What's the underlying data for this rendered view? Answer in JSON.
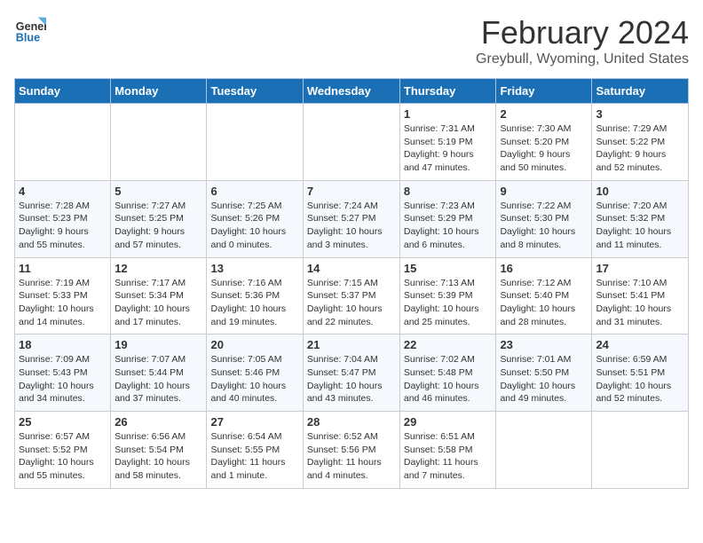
{
  "header": {
    "logo_line1": "General",
    "logo_line2": "Blue",
    "month_title": "February 2024",
    "location": "Greybull, Wyoming, United States"
  },
  "days_of_week": [
    "Sunday",
    "Monday",
    "Tuesday",
    "Wednesday",
    "Thursday",
    "Friday",
    "Saturday"
  ],
  "weeks": [
    [
      {
        "day": "",
        "info": ""
      },
      {
        "day": "",
        "info": ""
      },
      {
        "day": "",
        "info": ""
      },
      {
        "day": "",
        "info": ""
      },
      {
        "day": "1",
        "info": "Sunrise: 7:31 AM\nSunset: 5:19 PM\nDaylight: 9 hours\nand 47 minutes."
      },
      {
        "day": "2",
        "info": "Sunrise: 7:30 AM\nSunset: 5:20 PM\nDaylight: 9 hours\nand 50 minutes."
      },
      {
        "day": "3",
        "info": "Sunrise: 7:29 AM\nSunset: 5:22 PM\nDaylight: 9 hours\nand 52 minutes."
      }
    ],
    [
      {
        "day": "4",
        "info": "Sunrise: 7:28 AM\nSunset: 5:23 PM\nDaylight: 9 hours\nand 55 minutes."
      },
      {
        "day": "5",
        "info": "Sunrise: 7:27 AM\nSunset: 5:25 PM\nDaylight: 9 hours\nand 57 minutes."
      },
      {
        "day": "6",
        "info": "Sunrise: 7:25 AM\nSunset: 5:26 PM\nDaylight: 10 hours\nand 0 minutes."
      },
      {
        "day": "7",
        "info": "Sunrise: 7:24 AM\nSunset: 5:27 PM\nDaylight: 10 hours\nand 3 minutes."
      },
      {
        "day": "8",
        "info": "Sunrise: 7:23 AM\nSunset: 5:29 PM\nDaylight: 10 hours\nand 6 minutes."
      },
      {
        "day": "9",
        "info": "Sunrise: 7:22 AM\nSunset: 5:30 PM\nDaylight: 10 hours\nand 8 minutes."
      },
      {
        "day": "10",
        "info": "Sunrise: 7:20 AM\nSunset: 5:32 PM\nDaylight: 10 hours\nand 11 minutes."
      }
    ],
    [
      {
        "day": "11",
        "info": "Sunrise: 7:19 AM\nSunset: 5:33 PM\nDaylight: 10 hours\nand 14 minutes."
      },
      {
        "day": "12",
        "info": "Sunrise: 7:17 AM\nSunset: 5:34 PM\nDaylight: 10 hours\nand 17 minutes."
      },
      {
        "day": "13",
        "info": "Sunrise: 7:16 AM\nSunset: 5:36 PM\nDaylight: 10 hours\nand 19 minutes."
      },
      {
        "day": "14",
        "info": "Sunrise: 7:15 AM\nSunset: 5:37 PM\nDaylight: 10 hours\nand 22 minutes."
      },
      {
        "day": "15",
        "info": "Sunrise: 7:13 AM\nSunset: 5:39 PM\nDaylight: 10 hours\nand 25 minutes."
      },
      {
        "day": "16",
        "info": "Sunrise: 7:12 AM\nSunset: 5:40 PM\nDaylight: 10 hours\nand 28 minutes."
      },
      {
        "day": "17",
        "info": "Sunrise: 7:10 AM\nSunset: 5:41 PM\nDaylight: 10 hours\nand 31 minutes."
      }
    ],
    [
      {
        "day": "18",
        "info": "Sunrise: 7:09 AM\nSunset: 5:43 PM\nDaylight: 10 hours\nand 34 minutes."
      },
      {
        "day": "19",
        "info": "Sunrise: 7:07 AM\nSunset: 5:44 PM\nDaylight: 10 hours\nand 37 minutes."
      },
      {
        "day": "20",
        "info": "Sunrise: 7:05 AM\nSunset: 5:46 PM\nDaylight: 10 hours\nand 40 minutes."
      },
      {
        "day": "21",
        "info": "Sunrise: 7:04 AM\nSunset: 5:47 PM\nDaylight: 10 hours\nand 43 minutes."
      },
      {
        "day": "22",
        "info": "Sunrise: 7:02 AM\nSunset: 5:48 PM\nDaylight: 10 hours\nand 46 minutes."
      },
      {
        "day": "23",
        "info": "Sunrise: 7:01 AM\nSunset: 5:50 PM\nDaylight: 10 hours\nand 49 minutes."
      },
      {
        "day": "24",
        "info": "Sunrise: 6:59 AM\nSunset: 5:51 PM\nDaylight: 10 hours\nand 52 minutes."
      }
    ],
    [
      {
        "day": "25",
        "info": "Sunrise: 6:57 AM\nSunset: 5:52 PM\nDaylight: 10 hours\nand 55 minutes."
      },
      {
        "day": "26",
        "info": "Sunrise: 6:56 AM\nSunset: 5:54 PM\nDaylight: 10 hours\nand 58 minutes."
      },
      {
        "day": "27",
        "info": "Sunrise: 6:54 AM\nSunset: 5:55 PM\nDaylight: 11 hours\nand 1 minute."
      },
      {
        "day": "28",
        "info": "Sunrise: 6:52 AM\nSunset: 5:56 PM\nDaylight: 11 hours\nand 4 minutes."
      },
      {
        "day": "29",
        "info": "Sunrise: 6:51 AM\nSunset: 5:58 PM\nDaylight: 11 hours\nand 7 minutes."
      },
      {
        "day": "",
        "info": ""
      },
      {
        "day": "",
        "info": ""
      }
    ]
  ]
}
